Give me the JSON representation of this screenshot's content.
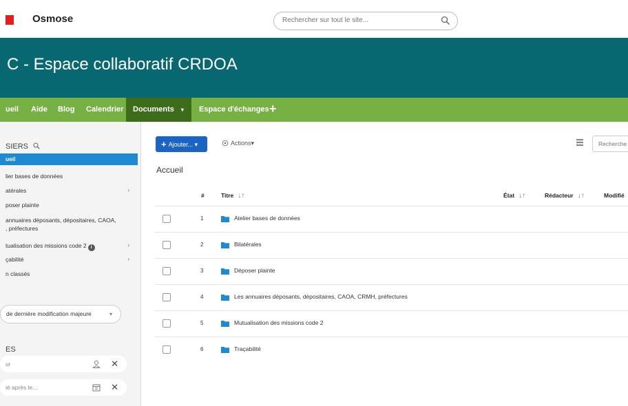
{
  "header": {
    "brand": "Osmose",
    "search_placeholder": "Rechercher sur tout le site..."
  },
  "banner": {
    "title": "C - Espace collaboratif CRDOA"
  },
  "nav": {
    "items": [
      {
        "label": "ueil"
      },
      {
        "label": "Aide"
      },
      {
        "label": "Blog"
      },
      {
        "label": "Calendrier"
      },
      {
        "label": "Documents",
        "caret": "▾",
        "active": true
      },
      {
        "label": "Espace d'échanges"
      }
    ],
    "plus": "+"
  },
  "sidebar": {
    "header": "SIERS",
    "items": [
      {
        "label": "ueil",
        "active": true
      },
      {
        "label": "lier bases de données"
      },
      {
        "label": "atérales",
        "chevron": "›"
      },
      {
        "label": "poser plainte"
      },
      {
        "label": "annuaires déposants, dépositaires, CAOA,"
      },
      {
        "label": ", préfectures"
      },
      {
        "label": "tualisation des missions code 2",
        "info": "i",
        "chevron": "›"
      },
      {
        "label": "çabilité",
        "chevron": "›"
      },
      {
        "label": "n classés"
      }
    ],
    "sort_select": {
      "label": "de dernière modification majeure",
      "caret": "▾"
    },
    "filters_header": "ES",
    "filters": [
      {
        "placeholder": "ur",
        "icon": "user-icon",
        "close": "✕"
      },
      {
        "placeholder": "ié après le...",
        "icon": "calendar-icon",
        "close": "✕"
      }
    ]
  },
  "main": {
    "add_button": "Ajouter...",
    "add_plus": "+",
    "add_caret": "▾",
    "actions": "Actions",
    "actions_caret": "▾",
    "search_placeholder": "Recherche",
    "breadcrumb": "Accueil",
    "columns": {
      "num": "#",
      "title": "Titre",
      "state": "État",
      "author": "Rédacteur",
      "modified": "Modifié",
      "sort": "↓↑"
    },
    "rows": [
      {
        "num": "1",
        "title": "Atelier bases de données"
      },
      {
        "num": "2",
        "title": "Bilatérales"
      },
      {
        "num": "3",
        "title": "Déposer plainte"
      },
      {
        "num": "4",
        "title": "Les annuaires déposants, dépositaires, CAOA, CRMH, préfectures"
      },
      {
        "num": "5",
        "title": "Mutualisation des missions code 2"
      },
      {
        "num": "6",
        "title": "Traçabilité"
      }
    ]
  },
  "colors": {
    "banner": "#086871",
    "nav": "#77b144",
    "nav_active": "#3d6c1a",
    "accent": "#1e8ad3",
    "add_button": "#1c64c4",
    "folder": "#1e8ad3",
    "logo": "#e0201c"
  }
}
